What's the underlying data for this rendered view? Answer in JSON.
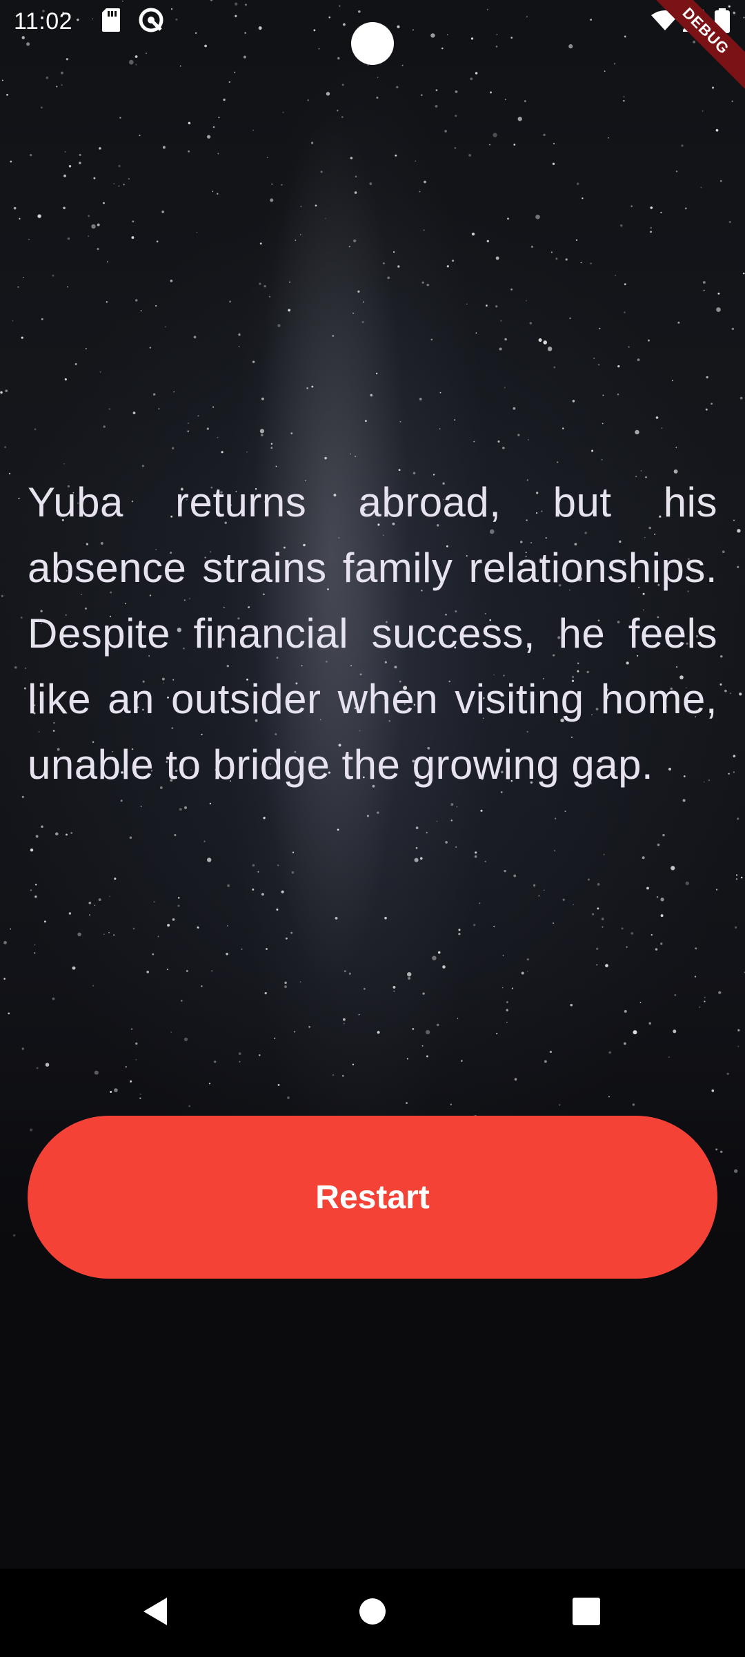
{
  "status_bar": {
    "time": "11:02",
    "icons": [
      "sd-card-icon",
      "vpn-key-icon",
      "wifi-icon",
      "signal-icon",
      "battery-icon"
    ]
  },
  "debug_banner": {
    "label": "DEBUG"
  },
  "story": {
    "text": "Yuba returns abroad, but his absence strains family relationships. Despite financial success, he feels like an outsider when visiting home, unable to bridge the growing gap."
  },
  "actions": {
    "restart_label": "Restart"
  },
  "nav_bar": {
    "icons": [
      "back-icon",
      "home-icon",
      "recents-icon"
    ]
  },
  "colors": {
    "accent": "#f44336",
    "text": "#e6e3ef",
    "background": "#0b0b0e",
    "debug": "#7a1216"
  }
}
